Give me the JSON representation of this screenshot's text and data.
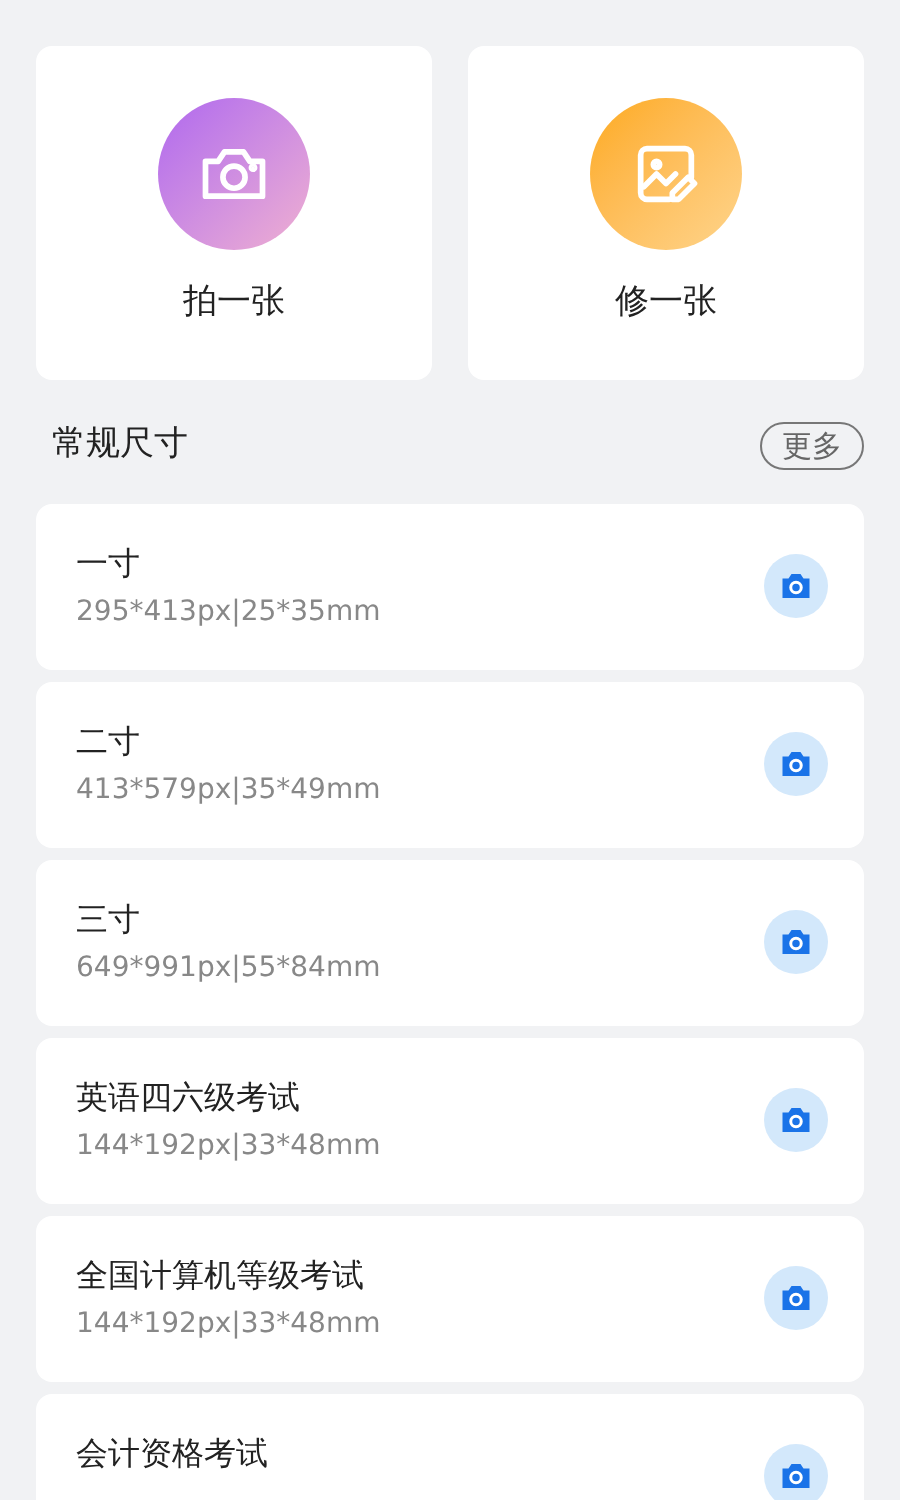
{
  "actions": [
    {
      "kind": "camera",
      "label": "拍一张"
    },
    {
      "kind": "edit",
      "label": "修一张"
    }
  ],
  "section": {
    "title": "常规尺寸",
    "more": "更多"
  },
  "sizes": [
    {
      "name": "一寸",
      "spec": "295*413px|25*35mm"
    },
    {
      "name": "二寸",
      "spec": "413*579px|35*49mm"
    },
    {
      "name": "三寸",
      "spec": "649*991px|55*84mm"
    },
    {
      "name": "英语四六级考试",
      "spec": "144*192px|33*48mm"
    },
    {
      "name": "全国计算机等级考试",
      "spec": "144*192px|33*48mm"
    },
    {
      "name": "会计资格考试"
    }
  ]
}
